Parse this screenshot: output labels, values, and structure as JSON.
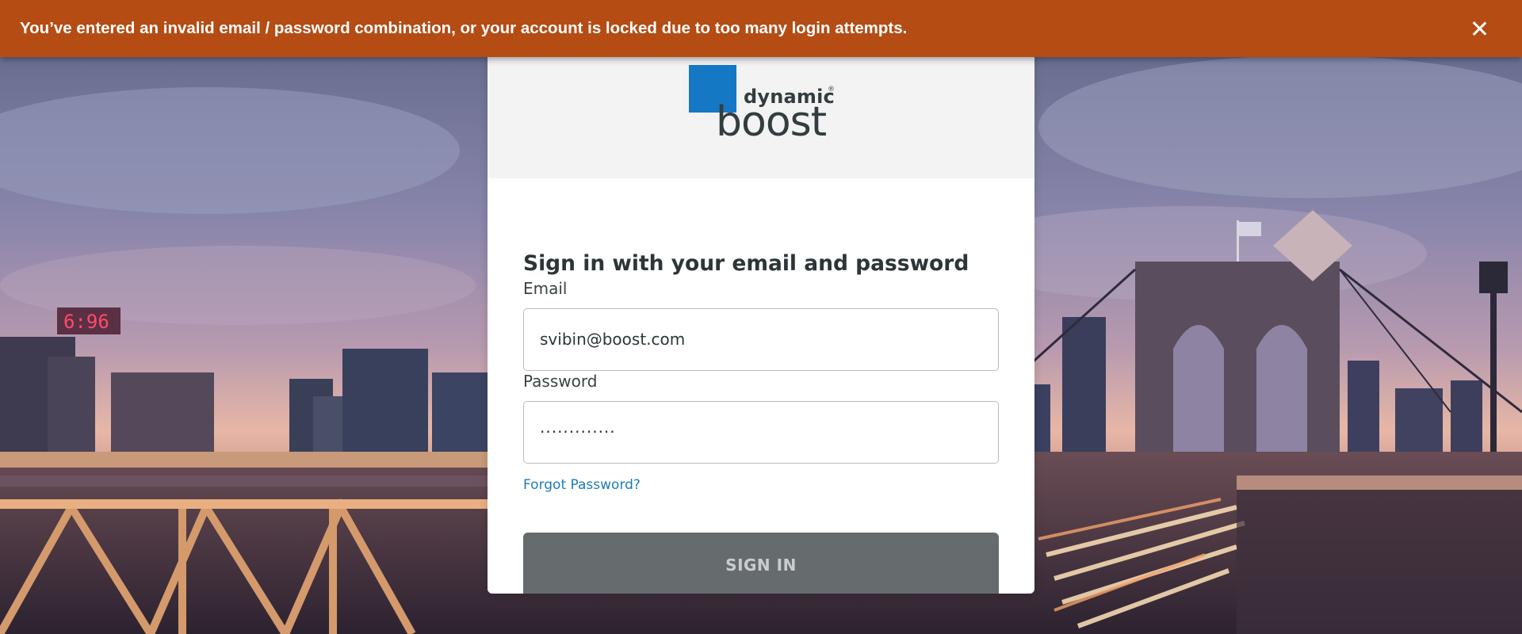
{
  "alert": {
    "message": "You’ve entered an invalid email / password combination, or your account is locked due to too many login attempts.",
    "close_icon": "close-icon",
    "color": "#b44c14"
  },
  "logo": {
    "word_top": "dynamic",
    "registered": "®",
    "word_bottom": "boost",
    "square_color": "#1578c4"
  },
  "form": {
    "heading": "Sign in with your email and password",
    "email_label": "Email",
    "email_value": "svibin@boost.com",
    "password_label": "Password",
    "password_masked": "·············",
    "forgot_link": "Forgot Password?",
    "signin_label": "SIGN IN"
  },
  "background": {
    "clock_text": "6:96"
  }
}
